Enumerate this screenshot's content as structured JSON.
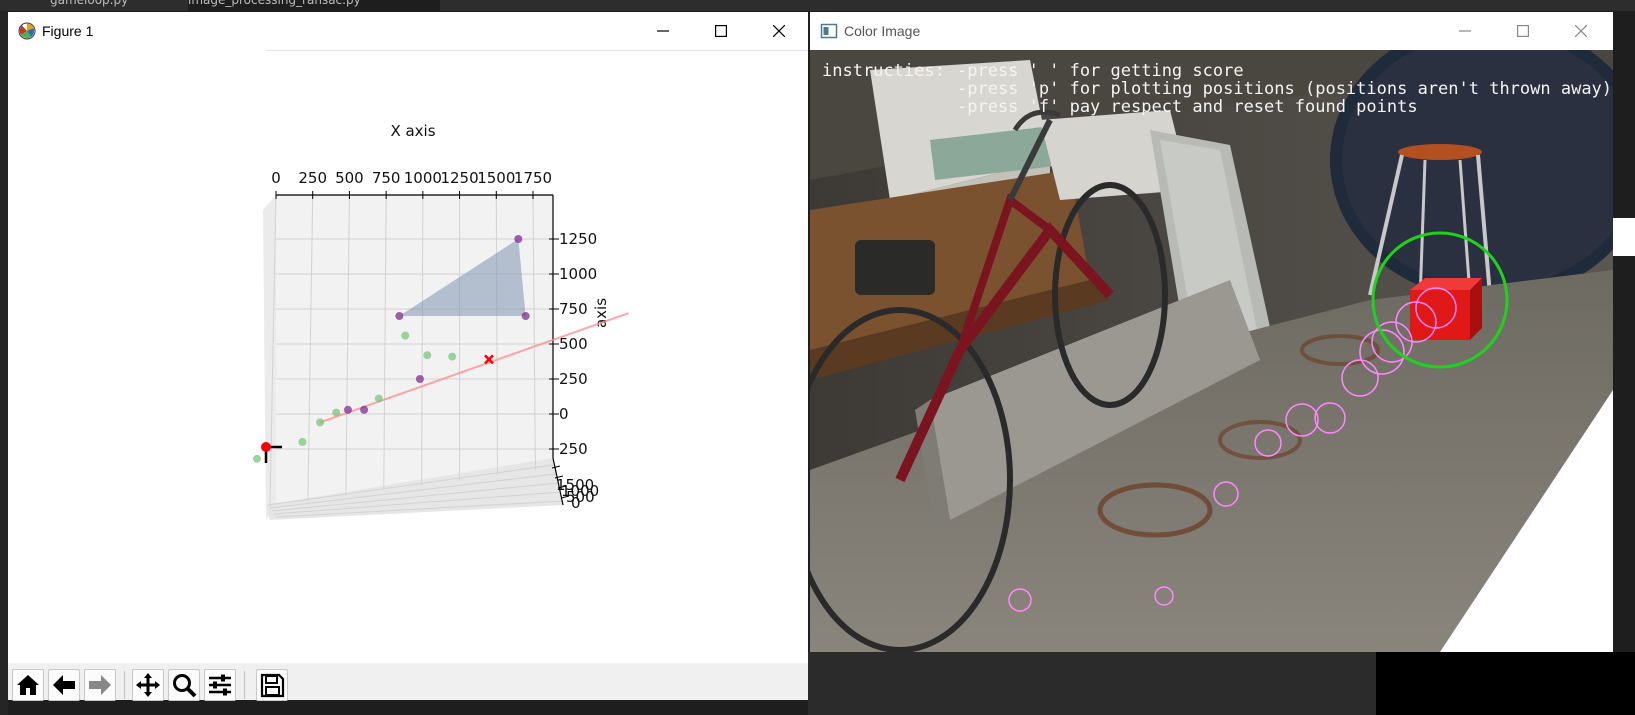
{
  "ide": {
    "tabs": [
      "gameloop.py",
      "image_processing_ransac.py"
    ]
  },
  "figure_window": {
    "title": "Figure 1",
    "toolbar_icons": [
      "home-icon",
      "back-arrow-icon",
      "forward-arrow-icon",
      "pan-icon",
      "zoom-icon",
      "configure-subplots-icon",
      "save-icon"
    ]
  },
  "camera_window": {
    "title": "Color Image",
    "instructions_label": "instructies:",
    "instructions": [
      "-press ' ' for getting score",
      "-press 'p' for plotting positions (positions aren't thrown away)",
      "-press 'f' pay respect and reset found points"
    ],
    "colors": {
      "target_circle": "#1ed21e",
      "trail_circles": "#ff88ff"
    }
  },
  "chart_data": {
    "type": "scatter",
    "projection": "3d",
    "xlabel": "X axis",
    "zlabel": "axis",
    "x_ticks": [
      "0",
      "250",
      "500",
      "750",
      "1000",
      "1250",
      "1500",
      "1750"
    ],
    "z_ticks": [
      "1250",
      "1000",
      "750",
      "500",
      "250",
      "0",
      "250"
    ],
    "y_ticks": [
      "1500",
      "1000",
      "500",
      "0"
    ],
    "grid": true,
    "series": [
      {
        "color": "#7d2f8f",
        "points": [
          [
            1650,
            1250
          ],
          [
            1700,
            700
          ],
          [
            840,
            700
          ],
          [
            980,
            250
          ],
          [
            490,
            30
          ],
          [
            600,
            30
          ]
        ]
      },
      {
        "color": "#7cc47c",
        "points": [
          [
            880,
            560
          ],
          [
            1030,
            420
          ],
          [
            1200,
            410
          ],
          [
            700,
            110
          ],
          [
            410,
            10
          ],
          [
            300,
            -60
          ],
          [
            180,
            -200
          ],
          [
            -130,
            -320
          ]
        ]
      }
    ],
    "colors": {
      "fit_line": "#ff8888",
      "plane": "#8094b0",
      "origin_marker": "#ff0000"
    }
  }
}
